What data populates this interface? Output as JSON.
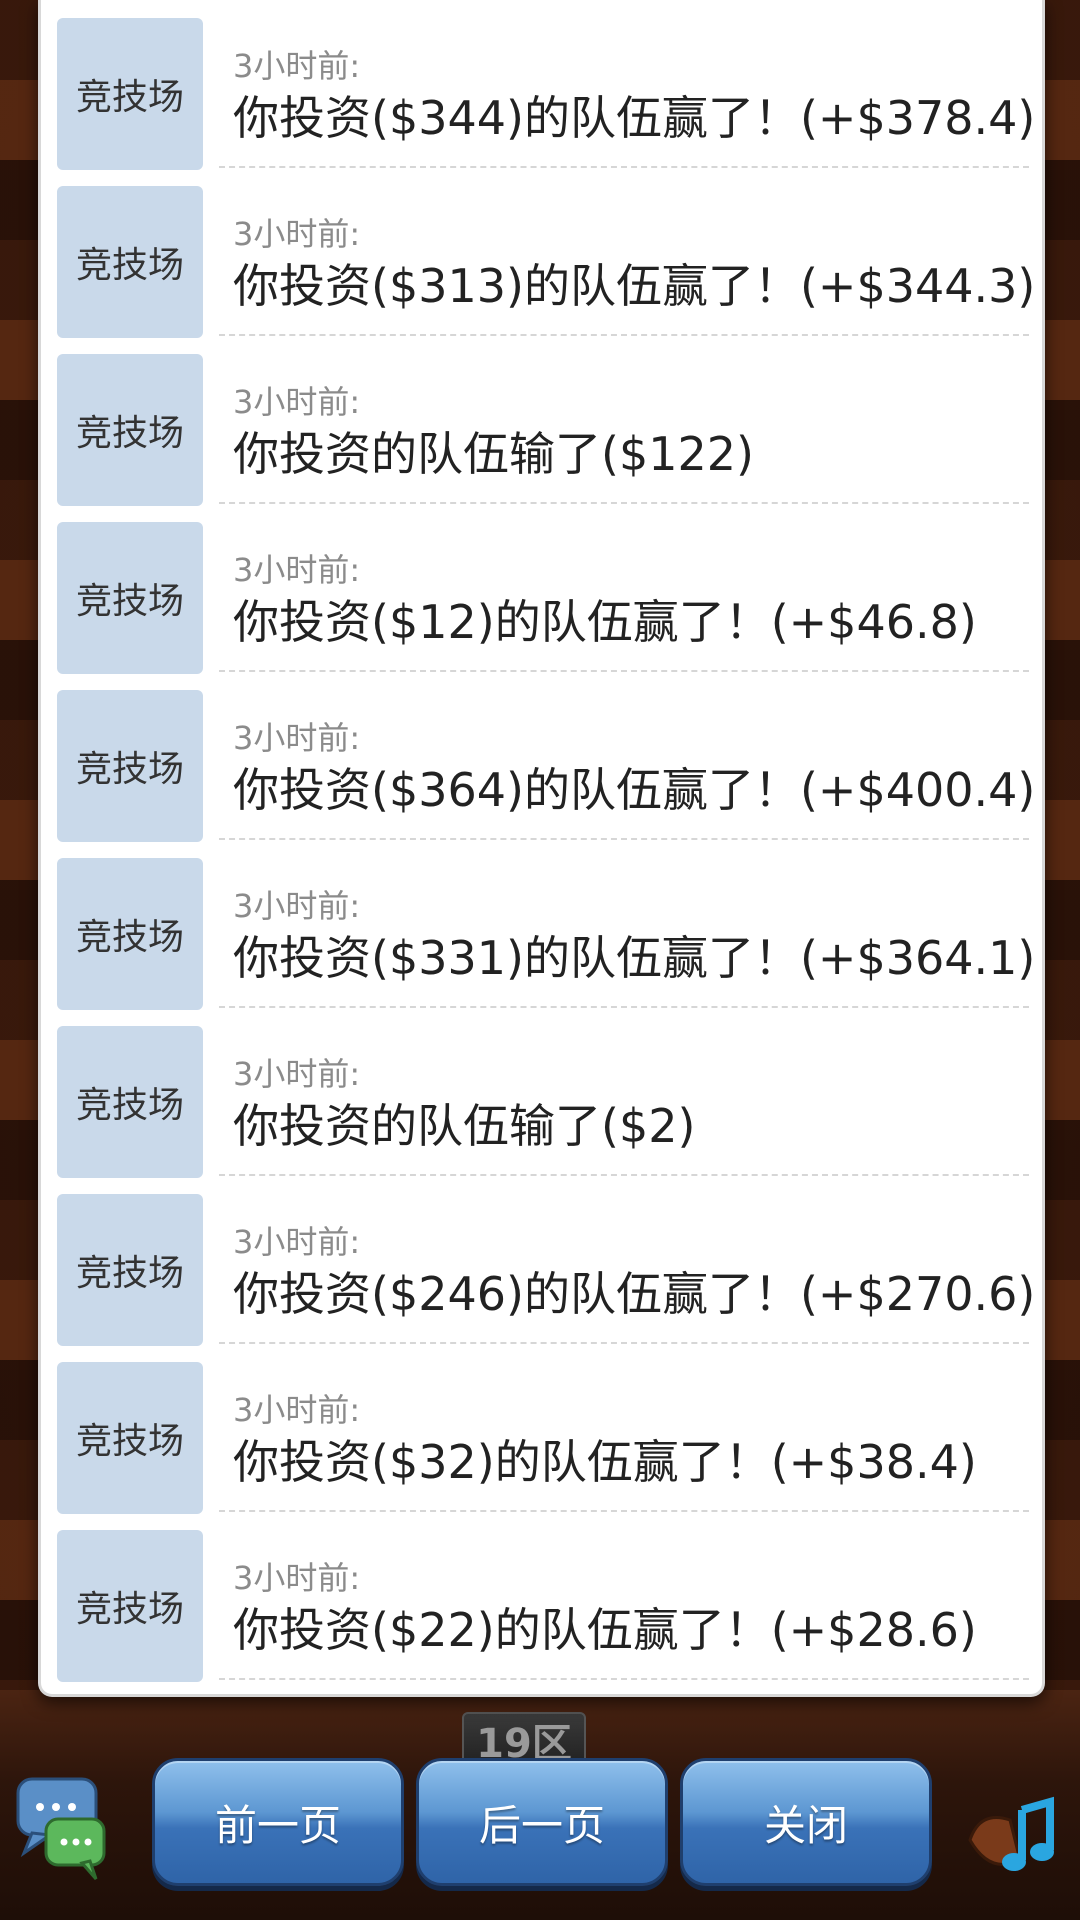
{
  "records": [
    {
      "tag": "竞技场",
      "time": "3小时前:",
      "message": "你投资($344)的队伍赢了！(+$378.4)"
    },
    {
      "tag": "竞技场",
      "time": "3小时前:",
      "message": "你投资($313)的队伍赢了！(+$344.3)"
    },
    {
      "tag": "竞技场",
      "time": "3小时前:",
      "message": "你投资的队伍输了($122)"
    },
    {
      "tag": "竞技场",
      "time": "3小时前:",
      "message": "你投资($12)的队伍赢了！(+$46.8)"
    },
    {
      "tag": "竞技场",
      "time": "3小时前:",
      "message": "你投资($364)的队伍赢了！(+$400.4)"
    },
    {
      "tag": "竞技场",
      "time": "3小时前:",
      "message": "你投资($331)的队伍赢了！(+$364.1)"
    },
    {
      "tag": "竞技场",
      "time": "3小时前:",
      "message": "你投资的队伍输了($2)"
    },
    {
      "tag": "竞技场",
      "time": "3小时前:",
      "message": "你投资($246)的队伍赢了！(+$270.6)"
    },
    {
      "tag": "竞技场",
      "time": "3小时前:",
      "message": "你投资($32)的队伍赢了！(+$38.4)"
    },
    {
      "tag": "竞技场",
      "time": "3小时前:",
      "message": "你投资($22)的队伍赢了！(+$28.6)"
    }
  ],
  "buttons": {
    "prev": "前一页",
    "next": "后一页",
    "close": "关闭"
  },
  "background": {
    "zone": "19区"
  },
  "icons": {
    "chat": "chat-bubbles-icon",
    "music": "music-note-icon"
  },
  "colors": {
    "tag_bg": "#c9d9ea",
    "button_blue": "#3a72b8"
  }
}
